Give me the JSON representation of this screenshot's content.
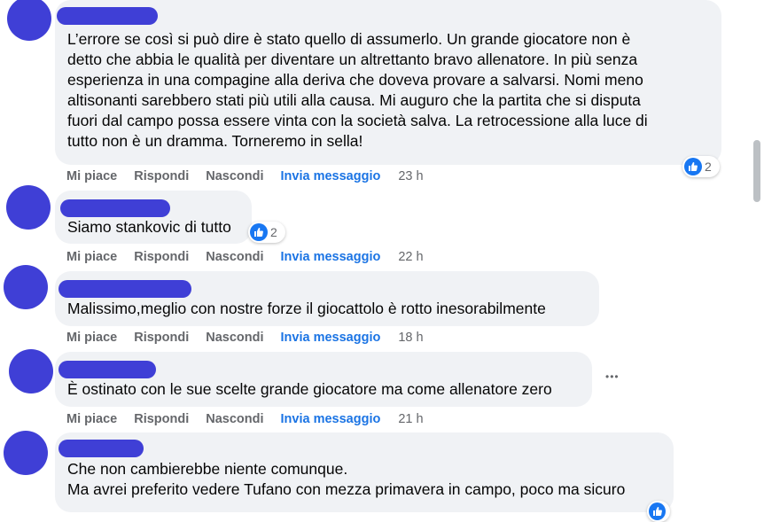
{
  "comments": [
    {
      "text": "L’errore se così si può dire è stato quello di assumerlo. Un grande giocatore non è\ndetto che abbia le qualità per diventare un altrettanto bravo allenatore. In più senza\nesperienza in una compagine alla deriva che doveva provare a salvarsi. Nomi meno\naltisonanti sarebbero stati più utili alla causa. Mi auguro che la partita che si disputa\nfuori dal campo possa essere vinta con la società salva. La retrocessione alla luce di\ntutto non è un dramma. Torneremo in sella!",
      "like": "Mi piace",
      "reply": "Rispondi",
      "hide": "Nascondi",
      "message": "Invia messaggio",
      "time": "23 h",
      "reactions": "2"
    },
    {
      "text": "Siamo stankovic di tutto",
      "like": "Mi piace",
      "reply": "Rispondi",
      "hide": "Nascondi",
      "message": "Invia messaggio",
      "time": "22 h",
      "reactions": "2"
    },
    {
      "text": "Malissimo,meglio con nostre forze il giocattolo è rotto inesorabilmente",
      "like": "Mi piace",
      "reply": "Rispondi",
      "hide": "Nascondi",
      "message": "Invia messaggio",
      "time": "18 h"
    },
    {
      "text": "È ostinato con le sue scelte grande giocatore ma come allenatore zero",
      "like": "Mi piace",
      "reply": "Rispondi",
      "hide": "Nascondi",
      "message": "Invia messaggio",
      "time": "21 h",
      "more": "•••"
    },
    {
      "text": "Che non cambierebbe niente comunque.\nMa avrei preferito vedere Tufano con mezza primavera in campo, poco ma sicuro"
    }
  ],
  "colors": {
    "redaction": "#3f3fd6",
    "bubble": "#f0f2f5",
    "link_blue": "#1b74e4",
    "action_gray": "#65676b",
    "like_blue": "#1877f2"
  },
  "icons": {
    "reaction": "like-thumb-icon",
    "more": "more-options-icon"
  }
}
